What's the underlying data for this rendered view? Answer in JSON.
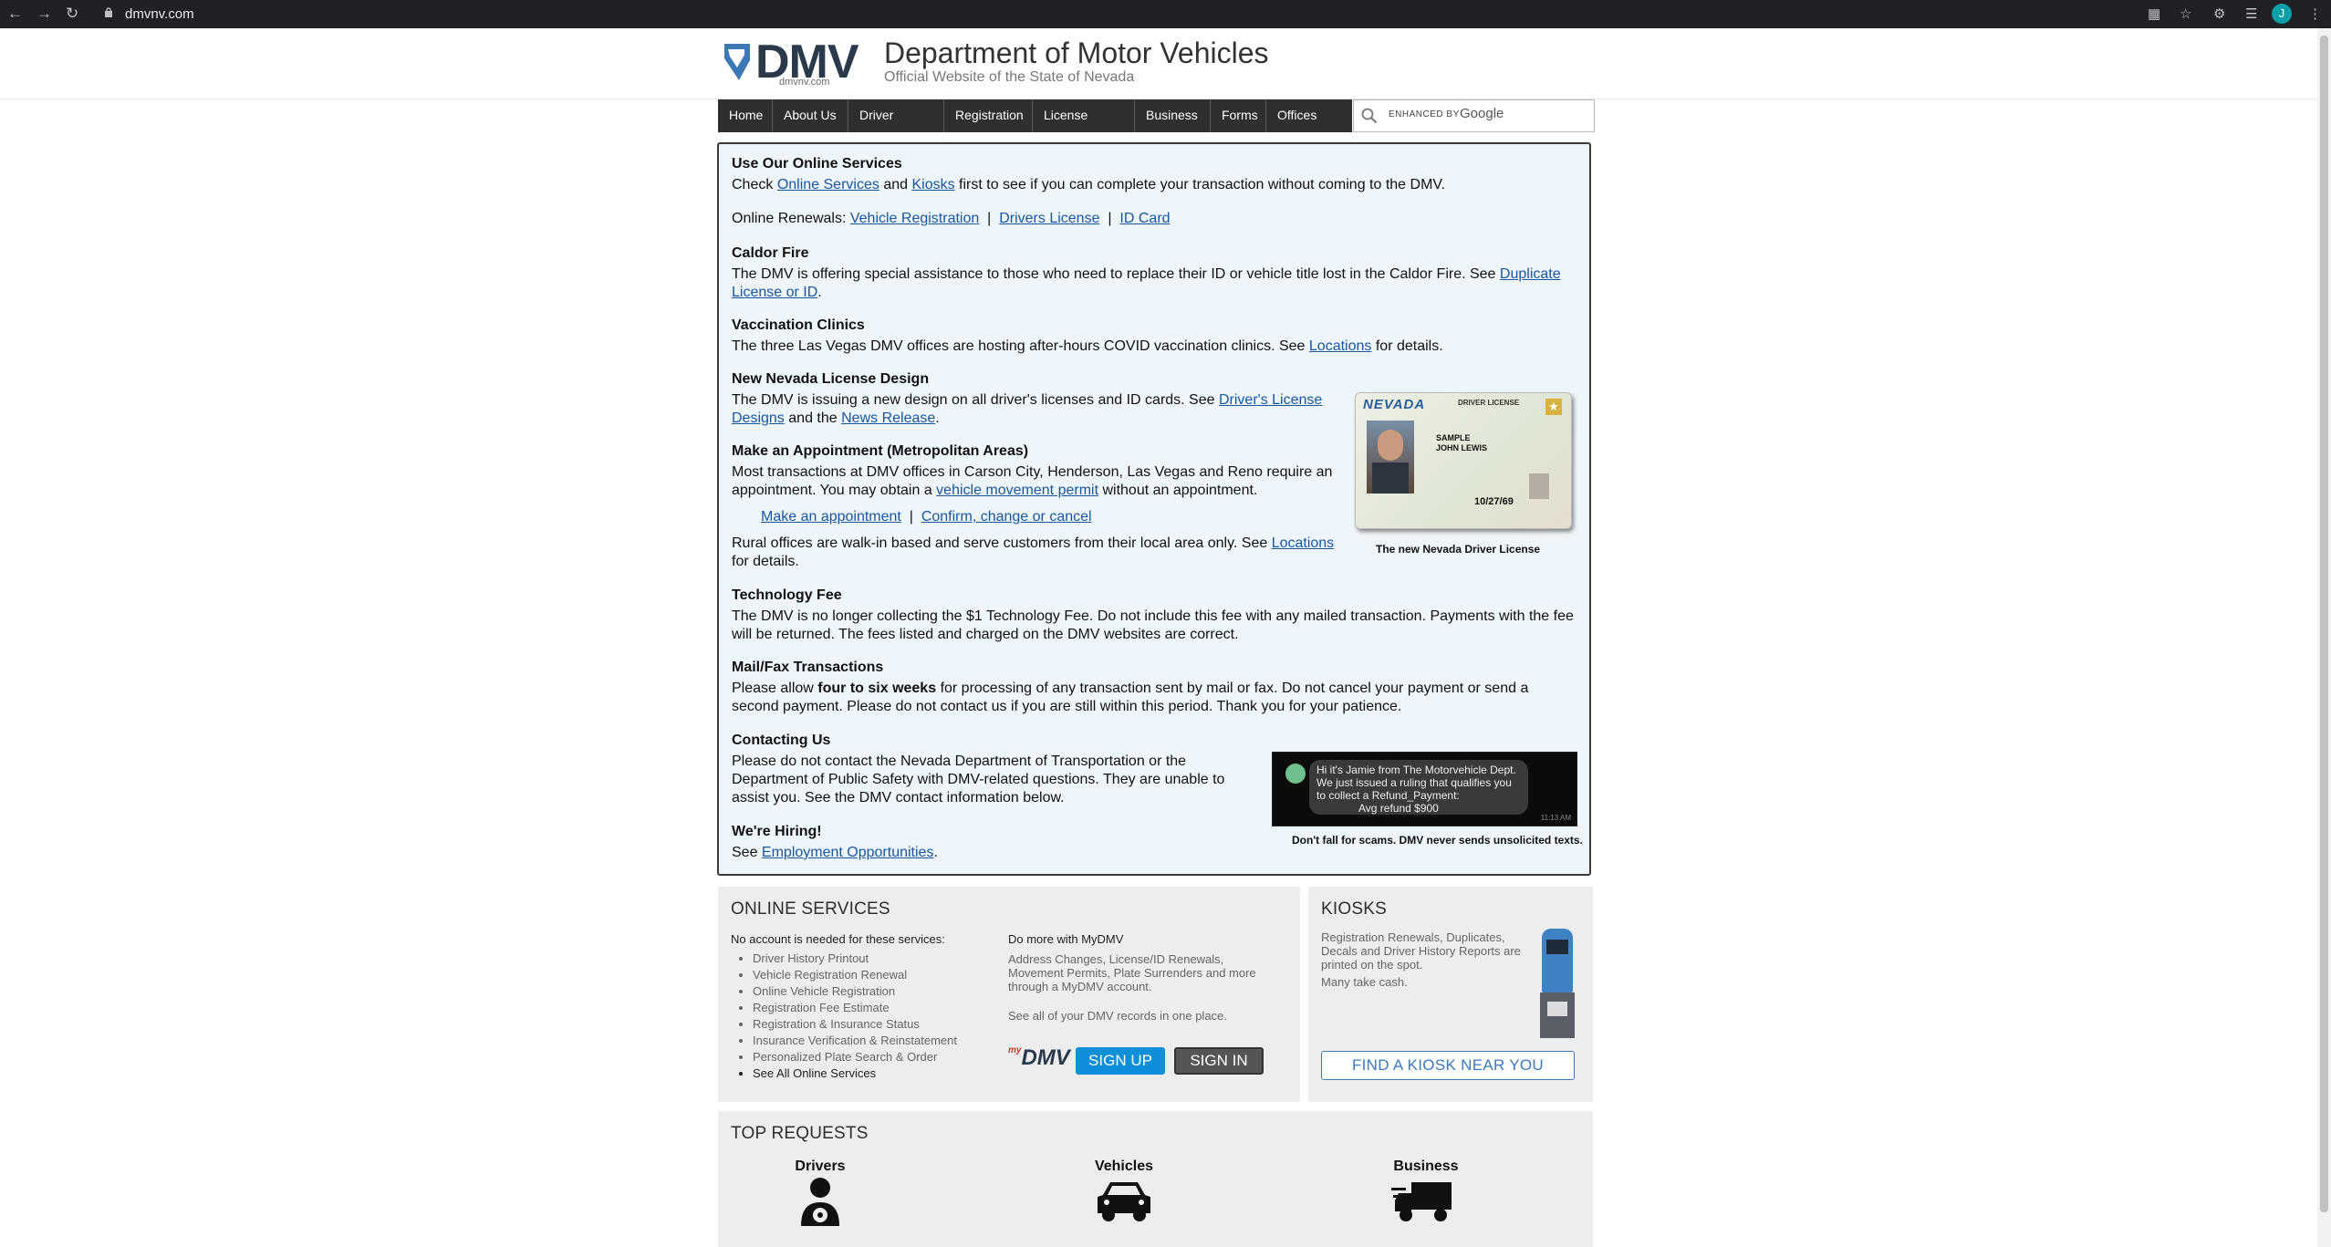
{
  "browser": {
    "url": "dmvnv.com",
    "avatar_letter": "J"
  },
  "header": {
    "logo_text": "DMV",
    "logo_sub": "dmvnv.com",
    "title": "Department of Motor Vehicles",
    "subtitle": "Official Website of the State of Nevada"
  },
  "nav": {
    "items": [
      "Home",
      "About Us",
      "Driver License",
      "Registration",
      "License Plates",
      "Business",
      "Forms",
      "Offices"
    ]
  },
  "search": {
    "enhanced": "ENHANCED BY",
    "google": "Google"
  },
  "notice": {
    "online": {
      "heading": "Use Our Online Services",
      "text1": "Check",
      "link1": "Online Services",
      "text2": "and",
      "link2": "Kiosks",
      "text3": "first to see if you can complete your transaction without coming to the DMV.",
      "renewals_label": "Online Renewals:",
      "renewals": [
        "Vehicle Registration",
        "Drivers License",
        "ID Card"
      ]
    },
    "caldor": {
      "heading": "Caldor Fire",
      "text": "The DMV is offering special assistance to those who need to replace their ID or vehicle title lost in the Caldor Fire. See",
      "link_a": "Duplicate",
      "link_b": "License or ID",
      "end": "."
    },
    "vaccination": {
      "heading": "Vaccination Clinics",
      "text": "The three Las Vegas DMV offices are hosting after-hours COVID vaccination clinics. See",
      "link": "Locations",
      "end": "for details."
    },
    "design": {
      "heading": "New Nevada License Design",
      "text": "The DMV is issuing a new design on all driver's licenses and ID cards. See",
      "link_a": "Driver's License",
      "link_b": "Designs",
      "mid": "and the",
      "link_c": "News Release",
      "end": "."
    },
    "appointment": {
      "heading": "Make an Appointment (Metropolitan Areas)",
      "line1": "Most transactions at DMV offices in Carson City, Henderson, Las Vegas and Reno require an",
      "line2a": "appointment. You may obtain a",
      "link": "vehicle movement permit",
      "line2b": "without an appointment.",
      "link_make": "Make an appointment",
      "link_confirm": "Confirm, change or cancel",
      "rural1": "Rural offices are walk-in based and serve customers from their local area only. See",
      "rural_link": "Locations",
      "rural2": "for details."
    },
    "tech": {
      "heading": "Technology Fee",
      "line1": "The DMV is no longer collecting the $1 Technology Fee. Do not include this fee with any mailed transaction. Payments with the fee",
      "line2": "will be returned. The fees listed and charged on the DMV websites are correct."
    },
    "mail": {
      "heading": "Mail/Fax Transactions",
      "a": "Please allow",
      "bold": "four to six weeks",
      "b": "for processing of any transaction sent by mail or fax. Do not cancel your payment or send a",
      "line2": "second payment. Please do not contact us if you are still within this period. Thank you for your patience."
    },
    "contact": {
      "heading": "Contacting Us",
      "line1": "Please do not contact the Nevada Department of Transportation or the",
      "line2": "Department of Public Safety with DMV-related questions. They are unable to",
      "line3": "assist you. See the DMV contact information below."
    },
    "hiring": {
      "heading": "We're Hiring!",
      "text": "See",
      "link": "Employment Opportunities",
      "end": "."
    },
    "license_card": {
      "state": "NEVADA",
      "type": "DRIVER LICENSE",
      "name1": "SAMPLE",
      "name2": "JOHN LEWIS",
      "dob": "10/27/69",
      "caption": "The new Nevada Driver License"
    },
    "scam": {
      "message": "Hi it's Jamie from The Motorvehicle Dept. We just issued a ruling that qualifies you to collect a Refund_Payment:",
      "refund": "Avg refund $900",
      "time": "11:13 AM",
      "caption": "Don't fall for scams. DMV never sends unsolicited texts."
    }
  },
  "online_services": {
    "heading": "ONLINE SERVICES",
    "no_account": "No account is needed for these services:",
    "items": [
      "Driver History Printout",
      "Vehicle Registration Renewal",
      "Online Vehicle Registration",
      "Registration Fee Estimate",
      "Registration & Insurance Status",
      "Insurance Verification & Reinstatement",
      "Personalized Plate Search & Order",
      "See All Online Services"
    ],
    "mydmv_heading": "Do more with MyDMV",
    "mydmv_text": "Address Changes, License/ID Renewals, Movement Permits, Plate Surrenders and more through a MyDMV account.",
    "mydmv_records": "See all of your DMV records in one place.",
    "mydmv_logo": "DMV",
    "signup": "SIGN UP",
    "signin": "SIGN IN"
  },
  "kiosks": {
    "heading": "KIOSKS",
    "text": "Registration Renewals, Duplicates, Decals and Driver History Reports are printed on the spot.",
    "cash": "Many take cash.",
    "button": "FIND A KIOSK NEAR YOU"
  },
  "top_requests": {
    "heading": "TOP REQUESTS",
    "items": [
      "Drivers",
      "Vehicles",
      "Business"
    ]
  },
  "colors": {
    "link": "#1a55a0",
    "signup": "#0e8fd8",
    "signin": "#555555",
    "nav": "#2f2f2f"
  }
}
